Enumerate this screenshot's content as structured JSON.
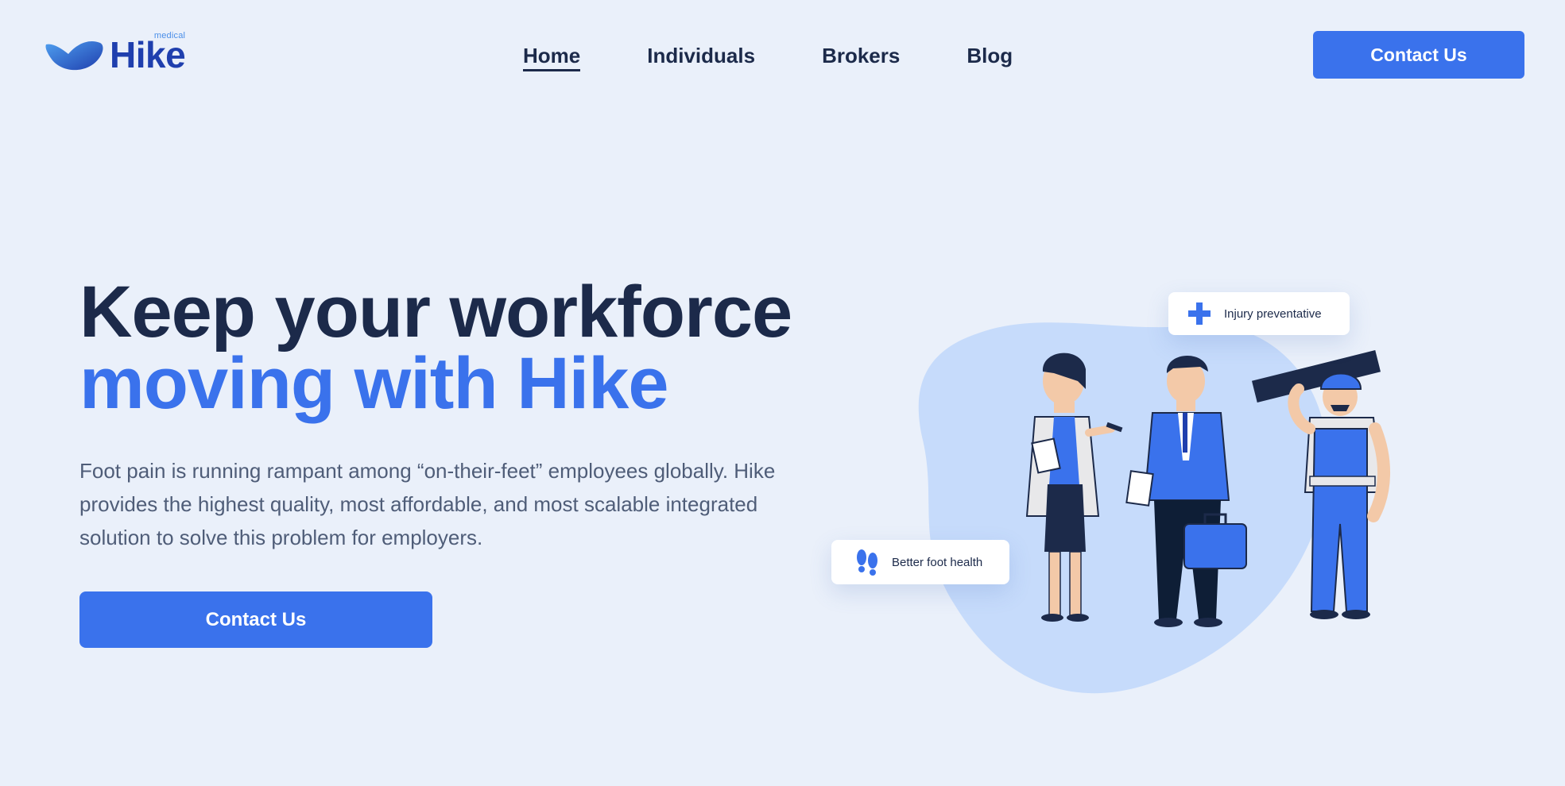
{
  "brand": {
    "name": "Hike",
    "sub": "medical",
    "colors": {
      "primary": "#3a72ec",
      "dark": "#1c2a4a",
      "logo": "#1f3fae",
      "background": "#eaf0fa"
    }
  },
  "nav": {
    "items": [
      {
        "label": "Home",
        "active": true
      },
      {
        "label": "Individuals",
        "active": false
      },
      {
        "label": "Brokers",
        "active": false
      },
      {
        "label": "Blog",
        "active": false
      }
    ]
  },
  "header": {
    "cta_label": "Contact Us"
  },
  "hero": {
    "title_line1": "Keep your workforce",
    "title_line2": "moving with Hike",
    "description": "Foot pain is running rampant among “on-their-feet” employees globally. Hike provides the highest quality, most affordable, and most scalable integrated solution to solve this problem for employers.",
    "cta_label": "Contact Us"
  },
  "illustration": {
    "badges": [
      {
        "icon": "medical-cross-icon",
        "label": "Injury preventative"
      },
      {
        "icon": "footprints-icon",
        "label": "Better foot health"
      }
    ]
  }
}
